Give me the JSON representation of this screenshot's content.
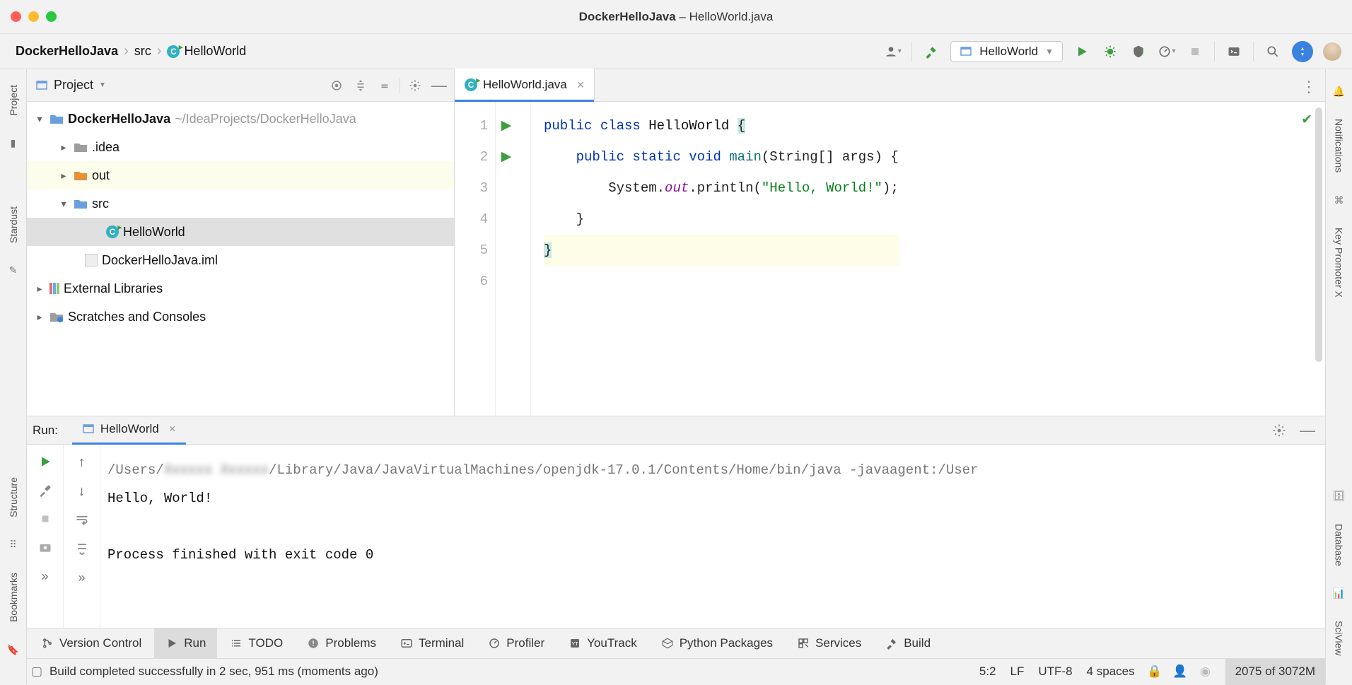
{
  "title": {
    "project": "DockerHelloJava",
    "file": "HelloWorld.java"
  },
  "breadcrumb": {
    "a": "DockerHelloJava",
    "b": "src",
    "c": "HelloWorld"
  },
  "run_config": {
    "selected": "HelloWorld"
  },
  "left_gutter": {
    "project": "Project",
    "stardust": "Stardust",
    "structure": "Structure",
    "bookmarks": "Bookmarks"
  },
  "right_gutter": {
    "notifications": "Notifications",
    "keypromoter": "Key Promoter X",
    "database": "Database",
    "sciview": "SciView"
  },
  "project_pane": {
    "header": "Project",
    "root": {
      "name": "DockerHelloJava",
      "path": "~/IdeaProjects/DockerHelloJava"
    },
    "idea": ".idea",
    "out": "out",
    "src": "src",
    "hello": "HelloWorld",
    "iml": "DockerHelloJava.iml",
    "ext": "External Libraries",
    "scratch": "Scratches and Consoles"
  },
  "editor": {
    "tab": "HelloWorld.java",
    "lines": {
      "l1a": "public",
      "l1b": "class",
      "l1c": "HelloWorld",
      "l2a": "public",
      "l2b": "static",
      "l2c": "void",
      "l2d": "main",
      "l2e": "(String[] args) {",
      "l3a": "System.",
      "l3b": "out",
      "l3c": ".println(",
      "l3d": "\"Hello, World!\"",
      "l3e": ");",
      "l4": "}",
      "l5": "}"
    },
    "gutter_nums": {
      "n1": "1",
      "n2": "2",
      "n3": "3",
      "n4": "4",
      "n5": "5",
      "n6": "6"
    }
  },
  "run_panel": {
    "label": "Run:",
    "tab": "HelloWorld",
    "cmd_prefix": "/Users/",
    "cmd_blur": "Xxxxxx Xxxxxx",
    "cmd_rest": "/Library/Java/JavaVirtualMachines/openjdk-17.0.1/Contents/Home/bin/java -javaagent:/User",
    "out1": "Hello, World!",
    "out2": "Process finished with exit code 0"
  },
  "bottom": {
    "vc": "Version Control",
    "run": "Run",
    "todo": "TODO",
    "problems": "Problems",
    "terminal": "Terminal",
    "profiler": "Profiler",
    "youtrack": "YouTrack",
    "pypkg": "Python Packages",
    "services": "Services",
    "build": "Build"
  },
  "status": {
    "msg": "Build completed successfully in 2 sec, 951 ms (moments ago)",
    "pos": "5:2",
    "lf": "LF",
    "enc": "UTF-8",
    "indent": "4 spaces",
    "mem": "2075 of 3072M"
  }
}
